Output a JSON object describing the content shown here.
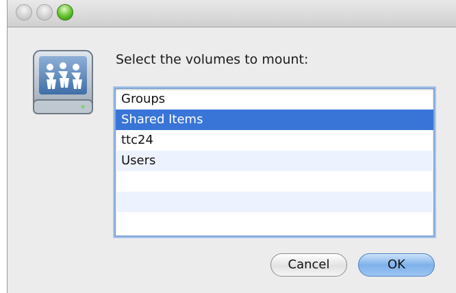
{
  "window": {
    "controls": [
      "close-button",
      "minimize-button",
      "zoom-button"
    ],
    "icon": "shared-network-volume-icon"
  },
  "dialog": {
    "prompt": "Select the volumes to mount:",
    "volumes": [
      {
        "label": "Groups",
        "selected": false
      },
      {
        "label": "Shared Items",
        "selected": true
      },
      {
        "label": "ttc24",
        "selected": false
      },
      {
        "label": "Users",
        "selected": false
      }
    ],
    "cancel_label": "Cancel",
    "ok_label": "OK"
  },
  "colors": {
    "selection": "#3875d7",
    "alt_row": "#edf3fe",
    "focus_ring": "#7fa7d8"
  }
}
